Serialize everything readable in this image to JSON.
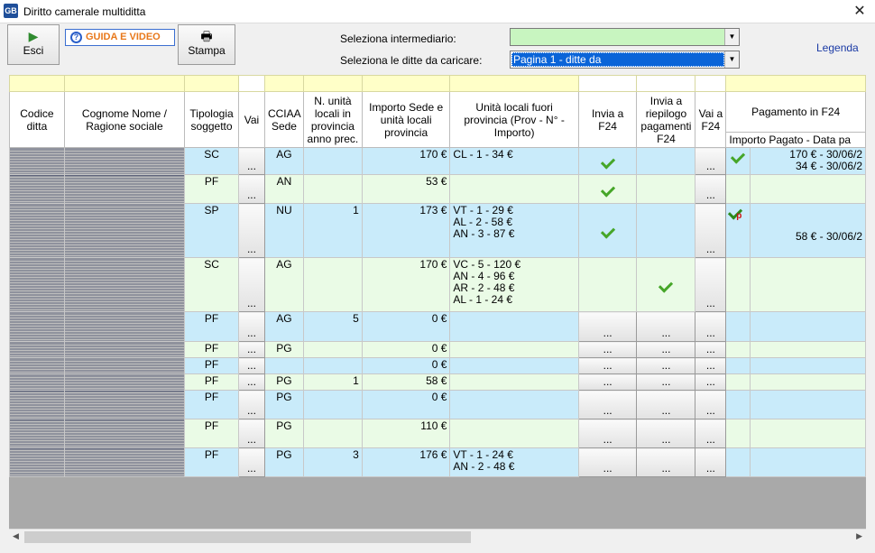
{
  "window": {
    "title": "Diritto camerale multiditta",
    "app_icon": "GB",
    "close": "✕"
  },
  "toolbar": {
    "esci": "Esci",
    "guida": "GUIDA E VIDEO",
    "stampa": "Stampa"
  },
  "filters": {
    "intermediario_label": "Seleziona intermediario:",
    "intermediario_value": "",
    "ditte_label": "Seleziona le ditte da caricare:",
    "ditte_value": "Pagina 1 - ditte da"
  },
  "legenda": "Legenda",
  "columns": {
    "codice": "Codice ditta",
    "nome": "Cognome Nome / Ragione sociale",
    "tipologia": "Tipologia soggetto",
    "vai": "Vai",
    "cciaa": "CCIAA Sede",
    "n_unita": "N. unità locali in provincia anno prec.",
    "importo": "Importo Sede e unità locali provincia",
    "fuori": "Unità locali fuori provincia (Prov - N° - Importo)",
    "invia": "Invia a F24",
    "riepilogo": "Invia a riepilogo pagamenti F24",
    "vai_f24": "Vai a F24",
    "pagamento": "Pagamento in F24",
    "importo_pagato": "Importo Pagato - Data pa"
  },
  "btn_dots": "...",
  "rows": [
    {
      "tipo": "SC",
      "cciaa": "AG",
      "n": "",
      "importo": "170 €",
      "fuori": [
        "CL - 1 - 34 €"
      ],
      "invia": "check",
      "riep": "",
      "pag_icon": "check",
      "pagato": [
        "170 € - 30/06/2",
        "34 € - 30/06/2"
      ]
    },
    {
      "tipo": "PF",
      "cciaa": "AN",
      "n": "",
      "importo": "53 €",
      "fuori": [],
      "invia": "check",
      "riep": "",
      "pag_icon": "",
      "pagato": []
    },
    {
      "tipo": "SP",
      "cciaa": "NU",
      "n": "1",
      "importo": "173 €",
      "fuori": [
        "VT - 1 - 29 €",
        "AL - 2 - 58 €",
        "AN - 3 - 87 €"
      ],
      "invia": "check",
      "riep": "",
      "pag_icon": "check-p",
      "pagato": [
        "",
        "58 € - 30/06/2"
      ]
    },
    {
      "tipo": "SC",
      "cciaa": "AG",
      "n": "",
      "importo": "170 €",
      "fuori": [
        "VC - 5 - 120 €",
        "AN - 4 - 96 €",
        "AR - 2 - 48 €",
        "AL - 1 - 24 €"
      ],
      "invia": "",
      "riep": "check",
      "pag_icon": "",
      "pagato": []
    },
    {
      "tipo": "PF",
      "cciaa": "AG",
      "n": "5",
      "importo": "0 €",
      "fuori": [],
      "invia": "btn",
      "riep": "btn",
      "pag_icon": "",
      "pagato": []
    },
    {
      "tipo": "PF",
      "cciaa": "PG",
      "n": "",
      "importo": "0 €",
      "fuori": [],
      "invia": "btn",
      "riep": "btn",
      "pag_icon": "",
      "pagato": []
    },
    {
      "tipo": "PF",
      "cciaa": "",
      "n": "",
      "importo": "0 €",
      "fuori": [],
      "invia": "btn",
      "riep": "btn",
      "pag_icon": "",
      "pagato": []
    },
    {
      "tipo": "PF",
      "cciaa": "PG",
      "n": "1",
      "importo": "58 €",
      "fuori": [],
      "invia": "btn",
      "riep": "btn",
      "pag_icon": "",
      "pagato": []
    },
    {
      "tipo": "PF",
      "cciaa": "PG",
      "n": "",
      "importo": "0 €",
      "fuori": [],
      "invia": "btn",
      "riep": "btn",
      "pag_icon": "",
      "pagato": []
    },
    {
      "tipo": "PF",
      "cciaa": "PG",
      "n": "",
      "importo": "110 €",
      "fuori": [],
      "invia": "btn",
      "riep": "btn",
      "pag_icon": "",
      "pagato": []
    },
    {
      "tipo": "PF",
      "cciaa": "PG",
      "n": "3",
      "importo": "176 €",
      "fuori": [
        "VT - 1 - 24 €",
        "AN - 2 - 48 €"
      ],
      "invia": "btn",
      "riep": "btn",
      "pag_icon": "",
      "pagato": []
    }
  ],
  "colors": {
    "row_blue": "#c9ebfa",
    "row_green": "#eafbe6",
    "yellow": "#ffffc8",
    "combo_green": "#c8f5c0",
    "combo_selected": "#0a64d8",
    "legend_link": "#1a3aa5",
    "check": "#46a629"
  }
}
